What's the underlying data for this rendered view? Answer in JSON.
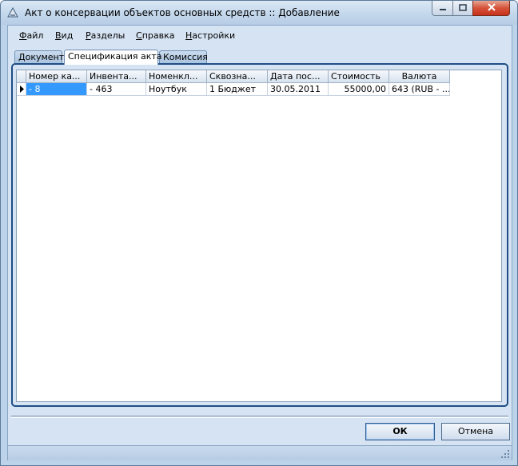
{
  "window": {
    "title": "Акт о консервации объектов основных средств :: Добавление",
    "icons": [
      "app-icon",
      "minimize-icon",
      "maximize-icon",
      "close-icon"
    ]
  },
  "menu": [
    "Файл",
    "Вид",
    "Разделы",
    "Справка",
    "Настройки"
  ],
  "tabs": [
    "Документ",
    "Спецификация акта",
    "Комиссия"
  ],
  "active_tab": "Спецификация акта",
  "grid": {
    "columns": [
      "Номер ка...",
      "Инвента...",
      "Номенкл...",
      "Сквозна...",
      "Дата пос...",
      "Стоимость",
      "Валюта"
    ],
    "rows": [
      [
        "- 8",
        "- 463",
        "Ноутбук",
        "1 Бюджет",
        "30.05.2011",
        "55000,00",
        "643 (RUB - ..."
      ]
    ]
  },
  "buttons": {
    "ok": "ОК",
    "cancel": "Отмена"
  },
  "colors": {
    "selection": "#3399ff",
    "titlebar": "#c3d7ec",
    "tab_border": "#1f4e86"
  }
}
